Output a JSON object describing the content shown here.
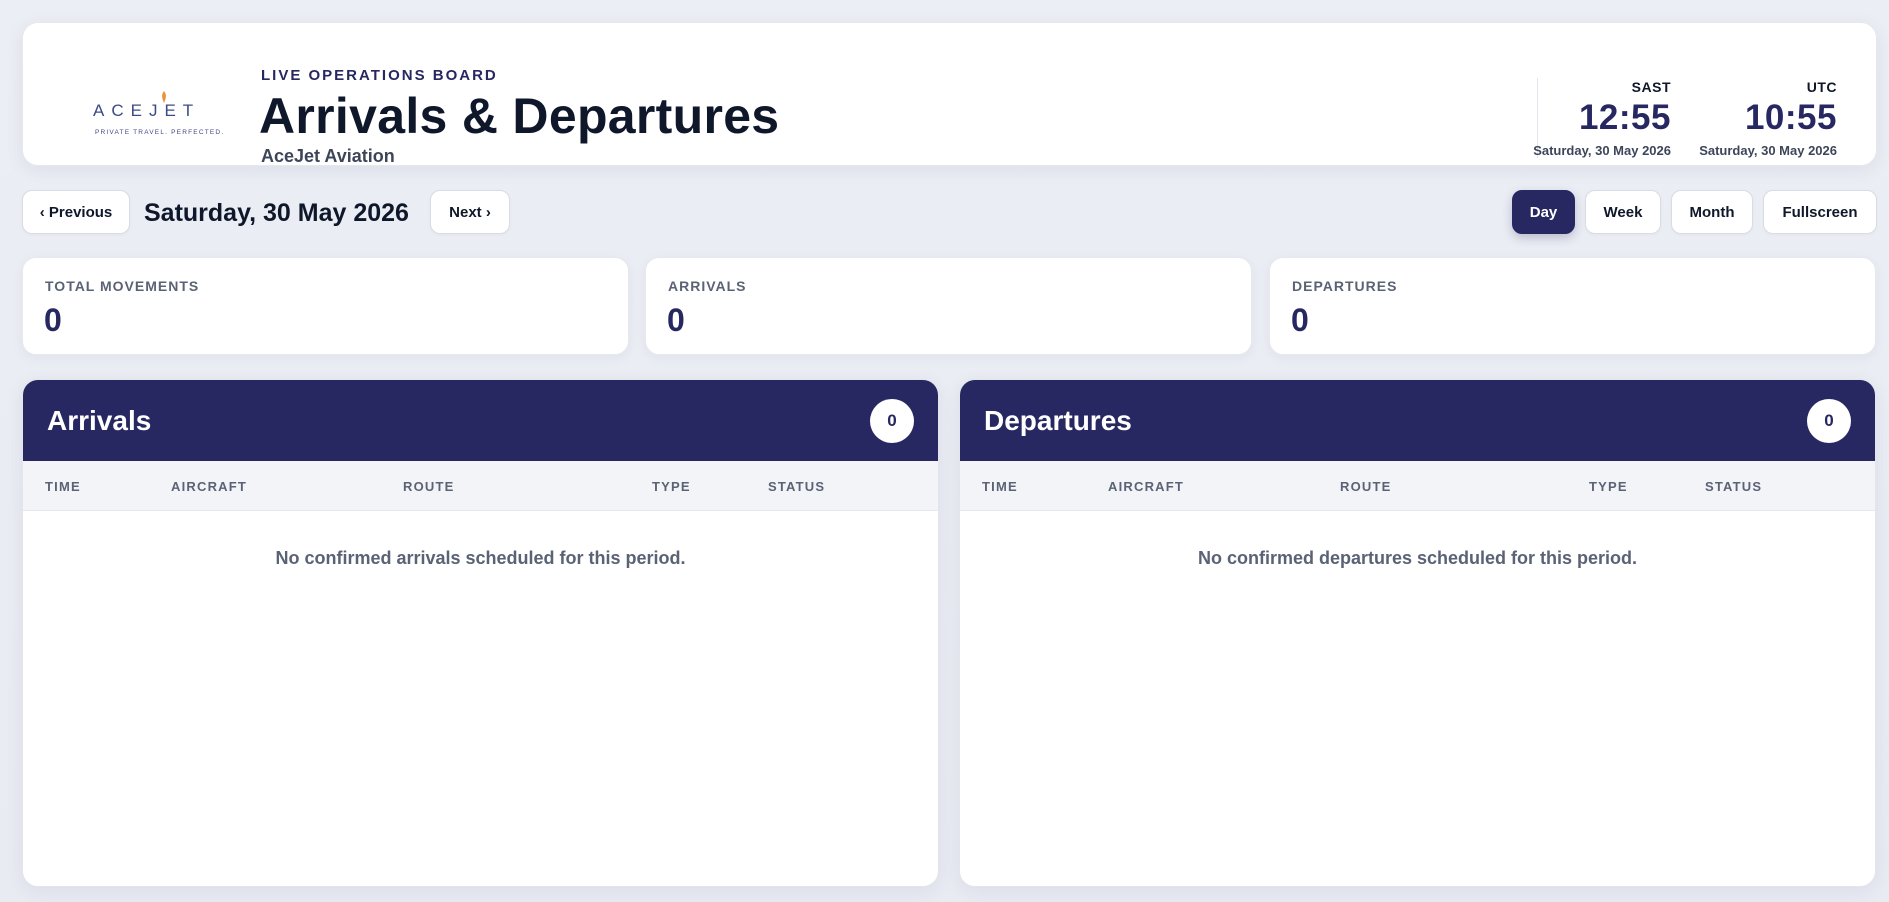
{
  "header": {
    "logo": {
      "wordmark": "ACEJET",
      "tagline": "PRIVATE TRAVEL. PERFECTED."
    },
    "eyebrow": "LIVE OPERATIONS BOARD",
    "title": "Arrivals & Departures",
    "subtitle": "AceJet Aviation",
    "clocks": [
      {
        "zone": "SAST",
        "time": "12:55",
        "date": "Saturday, 30 May 2026"
      },
      {
        "zone": "UTC",
        "time": "10:55",
        "date": "Saturday, 30 May 2026"
      }
    ]
  },
  "controls": {
    "previous_label": "‹ Previous",
    "date": "Saturday, 30 May 2026",
    "next_label": "Next ›",
    "views": [
      "Day",
      "Week",
      "Month"
    ],
    "active_view": "Day",
    "fullscreen_label": "Fullscreen"
  },
  "stats": [
    {
      "label": "TOTAL MOVEMENTS",
      "value": "0"
    },
    {
      "label": "ARRIVALS",
      "value": "0"
    },
    {
      "label": "DEPARTURES",
      "value": "0"
    }
  ],
  "columns": [
    "TIME",
    "AIRCRAFT",
    "ROUTE",
    "TYPE",
    "STATUS"
  ],
  "boards": {
    "arrivals": {
      "title": "Arrivals",
      "count": "0",
      "empty_message": "No confirmed arrivals scheduled for this period."
    },
    "departures": {
      "title": "Departures",
      "count": "0",
      "empty_message": "No confirmed departures scheduled for this period."
    }
  },
  "colors": {
    "brand_navy": "#272761",
    "accent_orange": "#e8923a"
  }
}
